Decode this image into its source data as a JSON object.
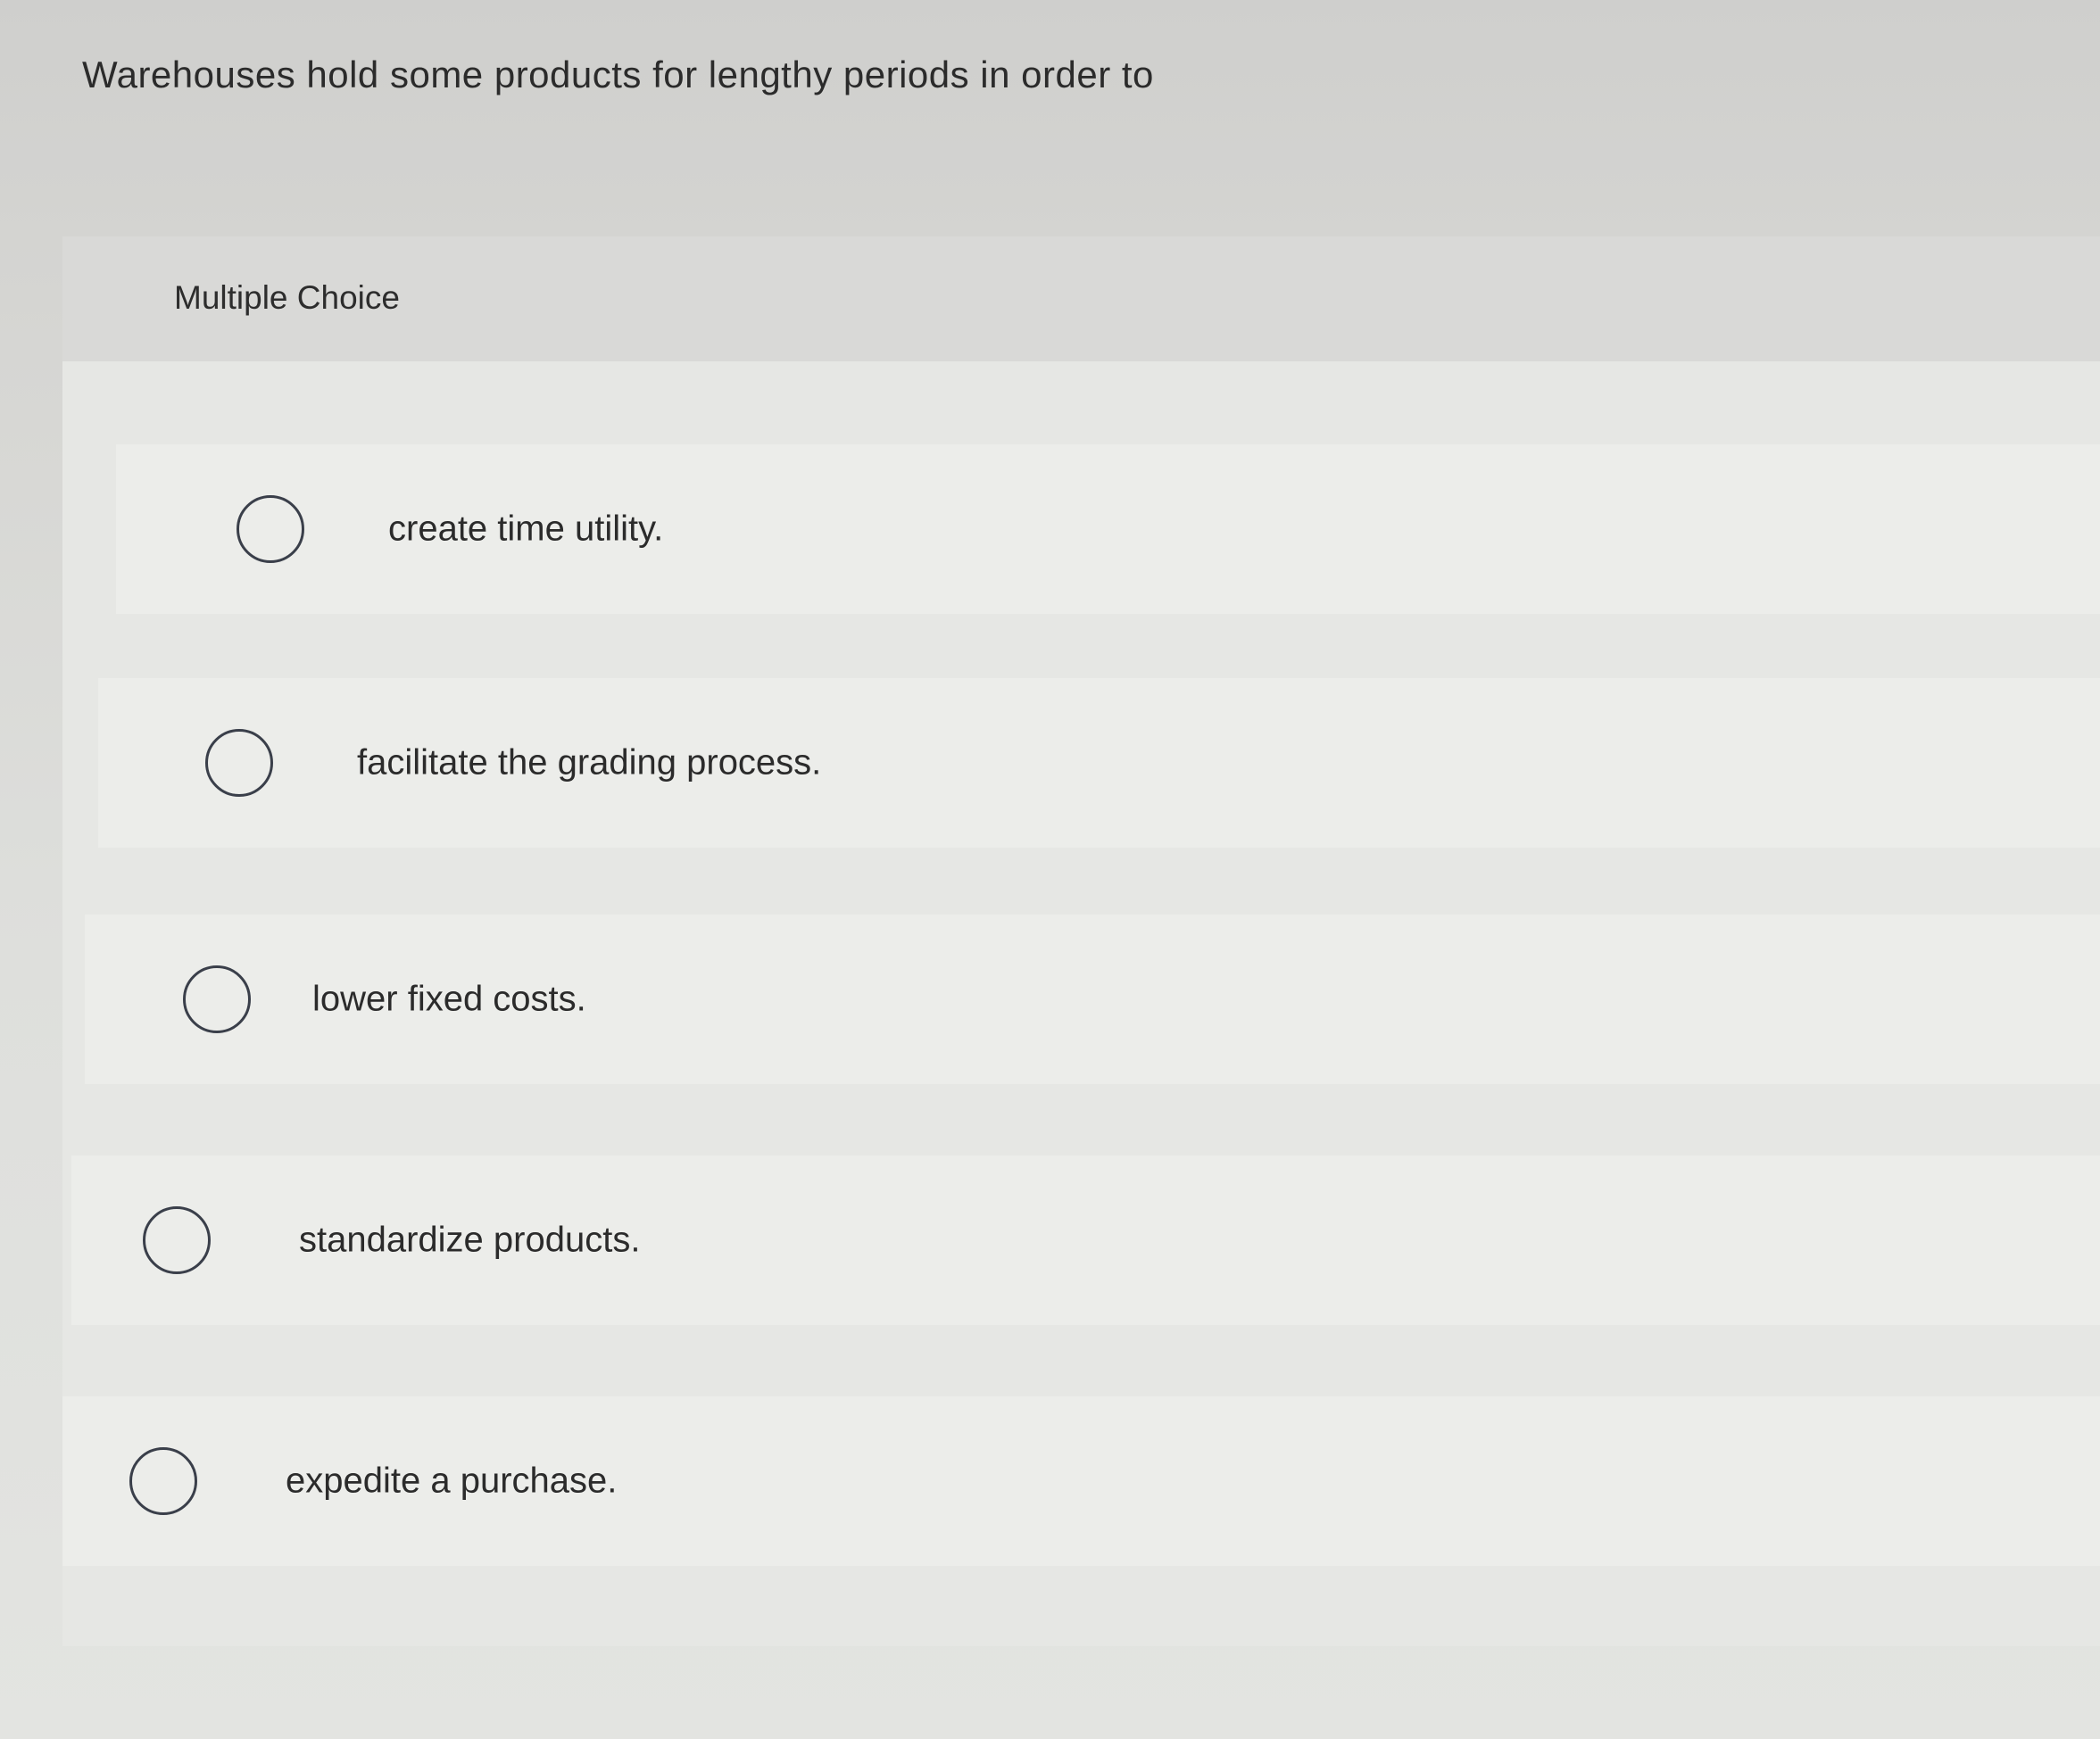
{
  "question": {
    "text": "Warehouses hold some products for lengthy periods in order to"
  },
  "multiple_choice": {
    "label": "Multiple Choice",
    "options": [
      {
        "label": "create time utility.",
        "selected": false
      },
      {
        "label": "facilitate the grading process.",
        "selected": false
      },
      {
        "label": "lower fixed costs.",
        "selected": false
      },
      {
        "label": "standardize products.",
        "selected": false
      },
      {
        "label": "expedite a purchase.",
        "selected": false
      }
    ]
  },
  "colors": {
    "radio_border": "#3a3f4a",
    "background": "#dedfdc",
    "option_background": "#ecedea"
  }
}
